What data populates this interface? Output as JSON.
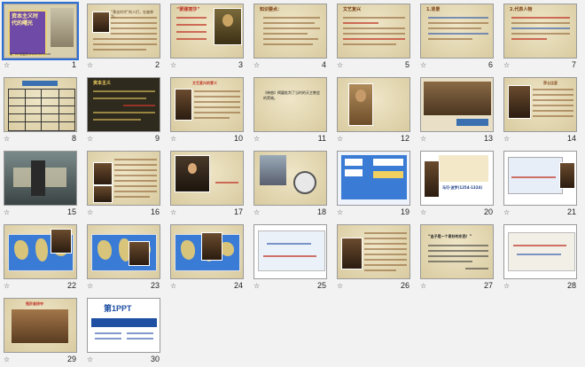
{
  "slides": [
    {
      "num": "1"
    },
    {
      "num": "2"
    },
    {
      "num": "3"
    },
    {
      "num": "4"
    },
    {
      "num": "5"
    },
    {
      "num": "6"
    },
    {
      "num": "7"
    },
    {
      "num": "8"
    },
    {
      "num": "9"
    },
    {
      "num": "10"
    },
    {
      "num": "11"
    },
    {
      "num": "12"
    },
    {
      "num": "13"
    },
    {
      "num": "14"
    },
    {
      "num": "15"
    },
    {
      "num": "16"
    },
    {
      "num": "17"
    },
    {
      "num": "18"
    },
    {
      "num": "19"
    },
    {
      "num": "20"
    },
    {
      "num": "21"
    },
    {
      "num": "22"
    },
    {
      "num": "23"
    },
    {
      "num": "24"
    },
    {
      "num": "25"
    },
    {
      "num": "26"
    },
    {
      "num": "27"
    },
    {
      "num": "28"
    },
    {
      "num": "29"
    },
    {
      "num": "30"
    }
  ],
  "slide_texts": {
    "s1_title": "资本主义时代的曙光",
    "s1_footer": "第一PPT模板网-WWW.1PPT.COM",
    "s2_text": "“黄金时代”的人们，在被称为...",
    "s3_title": "“蒙娜丽莎”",
    "s4_title": "知识要点：",
    "s5_title": "文艺复兴",
    "s6_title": "1.背景",
    "s7_title": "2.代表人物",
    "s9_title": "资本主义",
    "s10_title": "文艺复兴的意义",
    "s11_text": "《神曲》揭露批判了当时的天主教会的黑暗。",
    "s14_title": "莎士比亚",
    "s20_text": "马可·波罗(1254-1324)",
    "s27_text": "“金子是一个奇妙的东西！”",
    "s29_title": "殖民者掠夺",
    "s30_logo": "第1PPT"
  },
  "colors": {
    "parchment": "#e3d9b8",
    "title_red": "#c0392b",
    "title_gold": "#b8860b",
    "ocean": "#3a7bd5"
  },
  "icons": {
    "transition": "star-icon"
  }
}
